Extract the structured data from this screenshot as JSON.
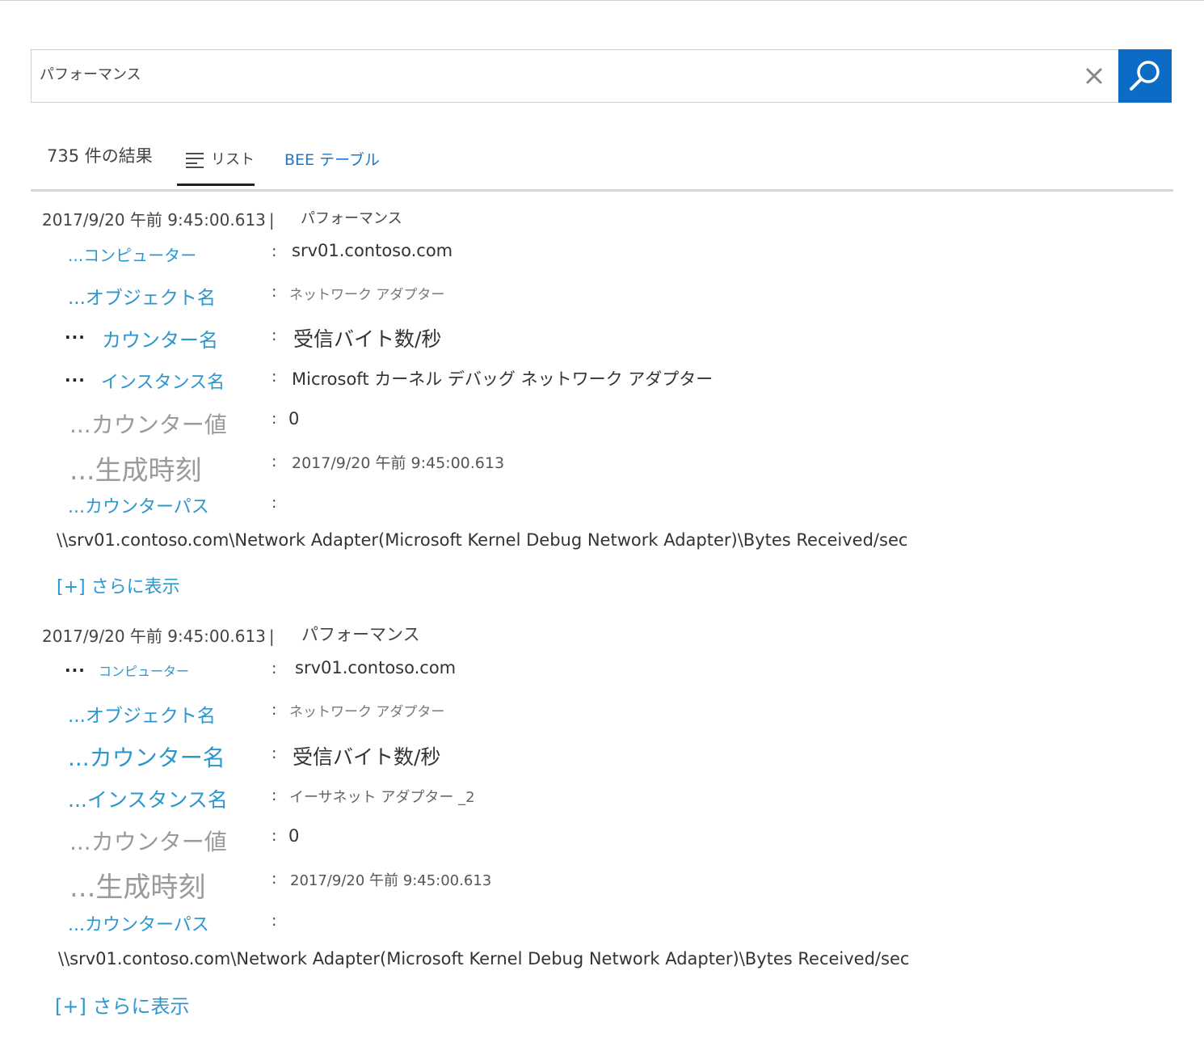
{
  "search": {
    "value": "パフォーマンス",
    "clear_icon": "close-icon",
    "search_icon": "search-icon",
    "button_color": "#0b6cc5"
  },
  "results": {
    "count_label": "735 件の結果",
    "tabs": [
      {
        "label": "リスト",
        "icon": "list-icon",
        "active": true
      },
      {
        "label": "BEE テーブル",
        "active": false
      }
    ]
  },
  "records": [
    {
      "timestamp": "2017/9/20 午前 9:45:00.613",
      "separator": "|",
      "type": "パフォーマンス",
      "fields": [
        {
          "label": "...コンピューター",
          "value": "srv01.contoso.com"
        },
        {
          "label": "...オブジェクト名",
          "value": "ネットワーク アダプター"
        },
        {
          "label": "カウンター名",
          "ellipsis": "...",
          "value": "受信バイト数/秒"
        },
        {
          "label": "インスタンス名",
          "ellipsis": "...",
          "value": "Microsoft カーネル デバッグ ネットワーク アダプター"
        },
        {
          "label": "...カウンター値",
          "value": "0"
        },
        {
          "label": "...生成時刻",
          "value": "2017/9/20 午前 9:45:00.613"
        },
        {
          "label": "...カウンターパス",
          "value": ""
        }
      ],
      "counter_path": "\\\\srv01.contoso.com\\Network Adapter(Microsoft Kernel Debug Network Adapter)\\Bytes Received/sec",
      "more_label": "[+] さらに表示"
    },
    {
      "timestamp": "2017/9/20 午前 9:45:00.613",
      "separator": "|",
      "type": "パフォーマンス",
      "fields": [
        {
          "label": "コンピューター",
          "ellipsis": "...",
          "value": "srv01.contoso.com"
        },
        {
          "label": "...オブジェクト名",
          "value": "ネットワーク アダプター"
        },
        {
          "label": "...カウンター名",
          "value": "受信バイト数/秒"
        },
        {
          "label": "...インスタンス名",
          "value": "イーサネット アダプター _2"
        },
        {
          "label": "...カウンター値",
          "value": "0"
        },
        {
          "label": "...生成時刻",
          "value": "2017/9/20 午前 9:45:00.613"
        },
        {
          "label": "...カウンターパス",
          "value": ""
        }
      ],
      "counter_path": "\\\\srv01.contoso.com\\Network Adapter(Microsoft Kernel Debug Network Adapter)\\Bytes Received/sec",
      "more_label": "[+] さらに表示"
    }
  ],
  "colon": ":"
}
